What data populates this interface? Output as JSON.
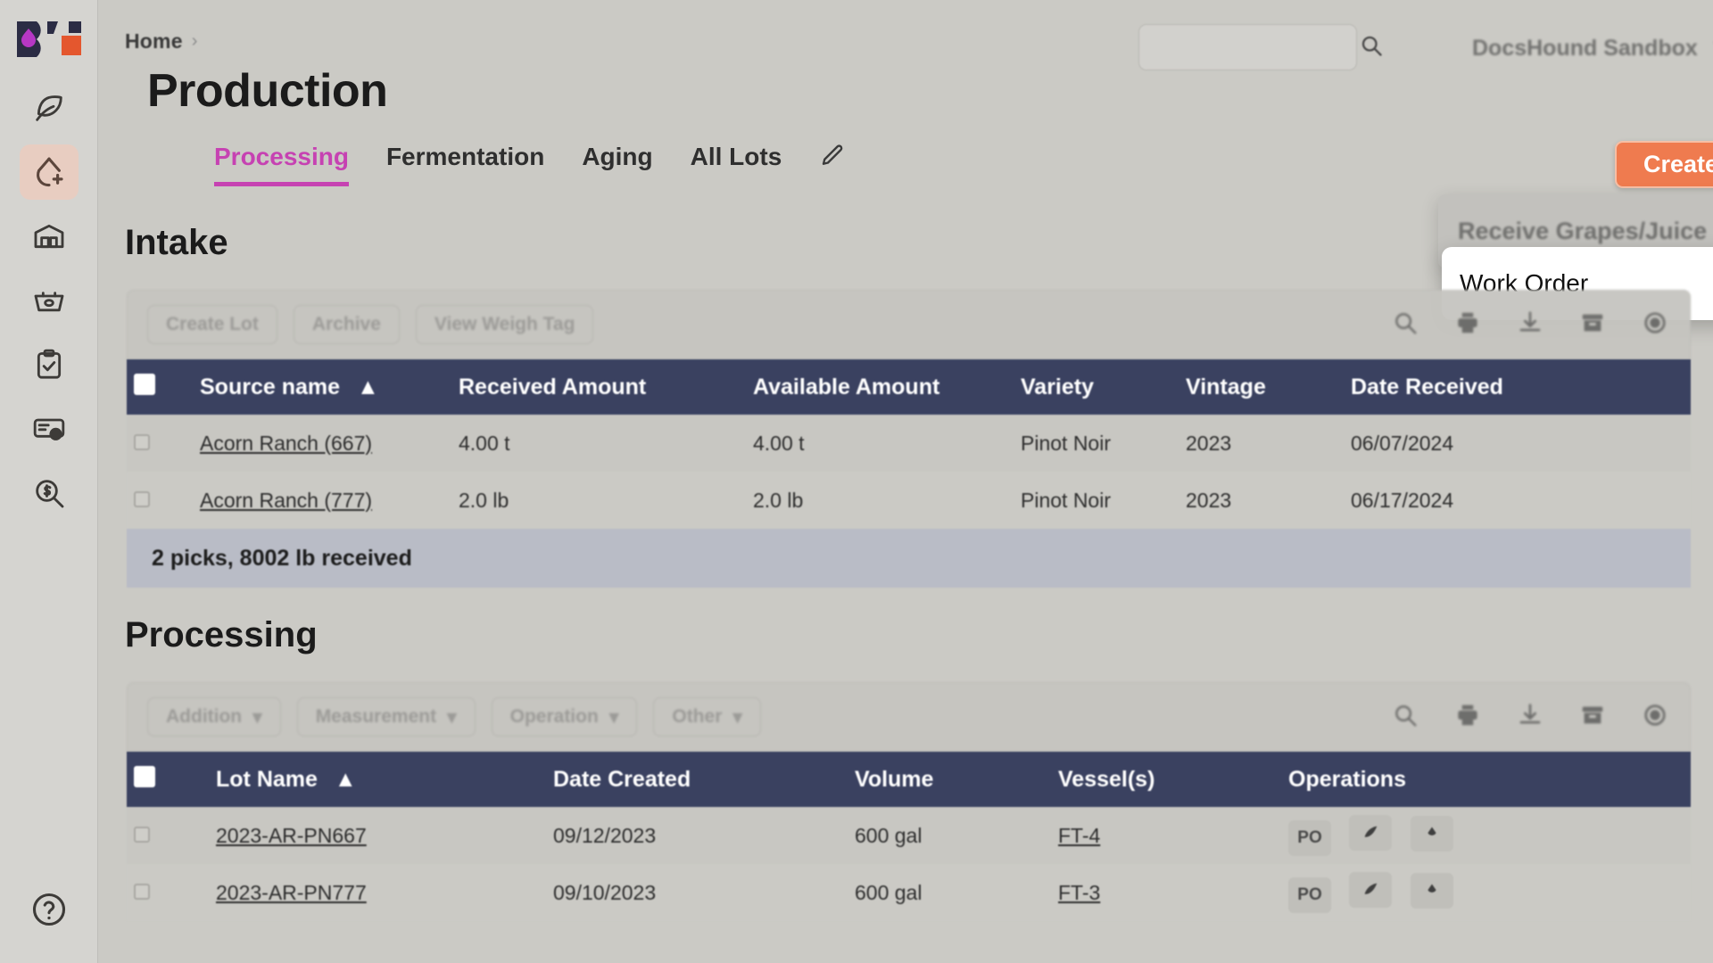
{
  "app": {
    "logo_name": "bottlebooks-logo",
    "brand_orange": "#ef7b4f",
    "brand_accent_pink": "#c642b2",
    "table_header_bg": "#3a4160"
  },
  "sidebar": {
    "items": [
      {
        "icon": "leaf-icon",
        "label": "Vineyard",
        "active": false
      },
      {
        "icon": "droplet-plus-icon",
        "label": "Production",
        "active": true
      },
      {
        "icon": "warehouse-icon",
        "label": "Warehouse",
        "active": false
      },
      {
        "icon": "basket-icon",
        "label": "Inventory",
        "active": false
      },
      {
        "icon": "clipboard-check-icon",
        "label": "Work Orders",
        "active": false
      },
      {
        "icon": "label-print-icon",
        "label": "Labels",
        "active": false
      },
      {
        "icon": "dollar-search-icon",
        "label": "Sales Analysis",
        "active": false
      }
    ],
    "help": {
      "icon": "help-circle-icon",
      "label": "Help"
    }
  },
  "header": {
    "breadcrumb": "Home",
    "breadcrumb_separator": "›",
    "title": "Production",
    "search": {
      "value": "",
      "placeholder": "",
      "icon": "search-icon"
    },
    "org": {
      "name": "DocsHound Sandbox",
      "chevron": "chevron-down-icon"
    }
  },
  "tabs": [
    {
      "label": "Processing",
      "active": true
    },
    {
      "label": "Fermentation",
      "active": false
    },
    {
      "label": "Aging",
      "active": false
    },
    {
      "label": "All Lots",
      "active": false
    }
  ],
  "tab_edit_icon": "pencil-icon",
  "create": {
    "label": "Create",
    "chevron": "chevron-down-icon",
    "menu_items": [
      {
        "label": "Receive Grapes/Juice",
        "highlighted": false
      },
      {
        "label": "Work Order",
        "highlighted": true
      }
    ]
  },
  "intake": {
    "title": "Intake",
    "toolbar_buttons": [
      "Create Lot",
      "Archive",
      "View Weigh Tag"
    ],
    "toolbar_icons": [
      "search-icon",
      "print-icon",
      "download-icon",
      "archive-icon",
      "settings-icon"
    ],
    "columns": [
      "Source name",
      "Received Amount",
      "Available Amount",
      "Variety",
      "Vintage",
      "Date Received"
    ],
    "sort_column": "Source name",
    "sort_direction": "asc",
    "sort_icon": "sort-asc-icon",
    "rows": [
      {
        "source_name": "Acorn Ranch (667)",
        "received_amount": "4.00 t",
        "available_amount": "4.00 t",
        "variety": "Pinot Noir",
        "vintage": "2023",
        "date_received": "06/07/2024"
      },
      {
        "source_name": "Acorn Ranch (777)",
        "received_amount": "2.0 lb",
        "available_amount": "2.0 lb",
        "variety": "Pinot Noir",
        "vintage": "2023",
        "date_received": "06/17/2024"
      }
    ],
    "footer": "2 picks, 8002 lb received"
  },
  "processing": {
    "title": "Processing",
    "toolbar_buttons": [
      "Addition",
      "Measurement",
      "Operation",
      "Other"
    ],
    "toolbar_icons": [
      "search-icon",
      "print-icon",
      "download-icon",
      "archive-icon",
      "settings-icon"
    ],
    "columns": [
      "Lot Name",
      "Date Created",
      "Volume",
      "Vessel(s)",
      "Operations"
    ],
    "sort_column": "Lot Name",
    "sort_direction": "asc",
    "sort_icon": "sort-asc-icon",
    "rows": [
      {
        "lot_name": "2023-AR-PN667",
        "date_created": "09/12/2023",
        "volume": "600 gal",
        "vessel": "FT-4",
        "operations": [
          "PO",
          "grape-icon",
          "droplet-icon"
        ]
      },
      {
        "lot_name": "2023-AR-PN777",
        "date_created": "09/10/2023",
        "volume": "600 gal",
        "vessel": "FT-3",
        "operations": [
          "PO",
          "grape-icon",
          "droplet-icon"
        ]
      }
    ]
  }
}
